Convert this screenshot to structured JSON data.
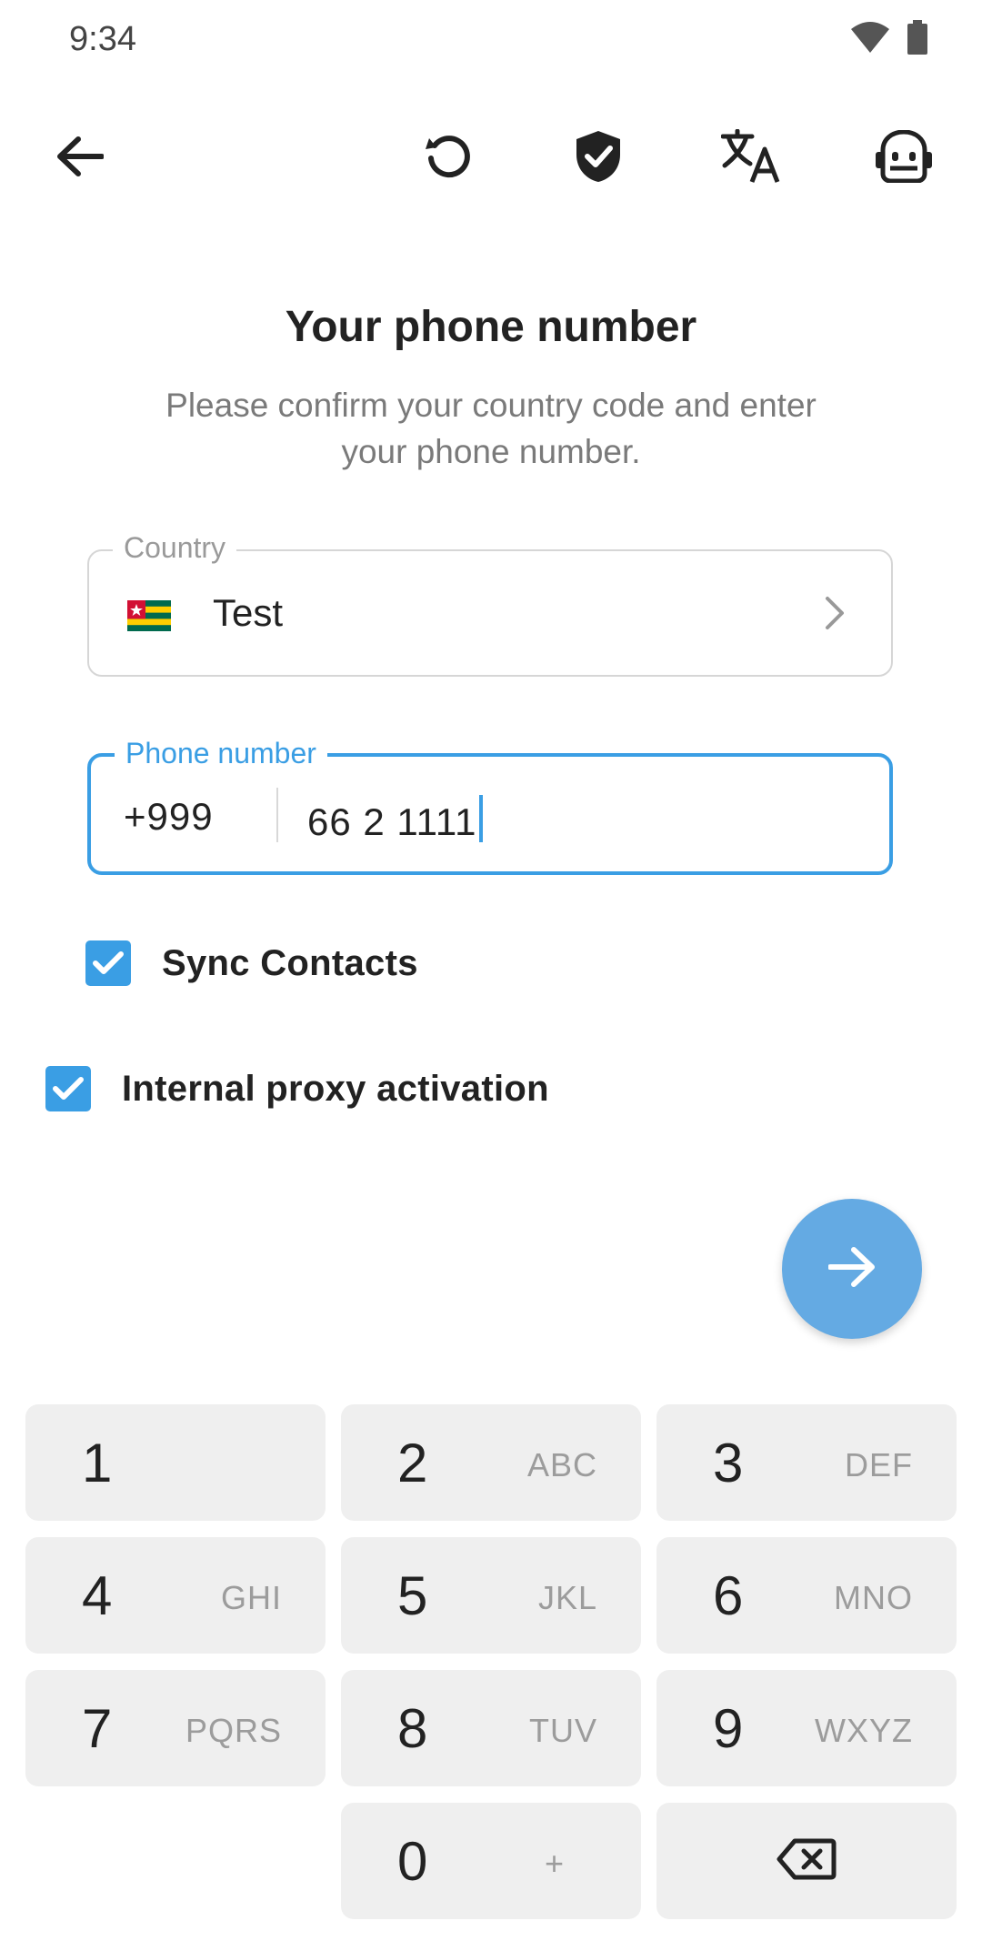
{
  "status_bar": {
    "time": "9:34"
  },
  "header": {
    "title": "Your phone number",
    "subtitle": "Please confirm your country code and enter your phone number."
  },
  "country_field": {
    "legend": "Country",
    "value": "Test",
    "flag": "togo-flag"
  },
  "phone_field": {
    "legend": "Phone number",
    "code": "+999",
    "number": "66 2 1111"
  },
  "checkboxes": {
    "sync_contacts": {
      "label": "Sync Contacts",
      "checked": true
    },
    "internal_proxy": {
      "label": "Internal proxy activation",
      "checked": true
    }
  },
  "toolbar_icons": [
    "back-arrow-icon",
    "reset-icon",
    "shield-check-icon",
    "translate-icon",
    "bot-icon"
  ],
  "keypad": {
    "keys": [
      {
        "digit": "1",
        "letters": ""
      },
      {
        "digit": "2",
        "letters": "ABC"
      },
      {
        "digit": "3",
        "letters": "DEF"
      },
      {
        "digit": "4",
        "letters": "GHI"
      },
      {
        "digit": "5",
        "letters": "JKL"
      },
      {
        "digit": "6",
        "letters": "MNO"
      },
      {
        "digit": "7",
        "letters": "PQRS"
      },
      {
        "digit": "8",
        "letters": "TUV"
      },
      {
        "digit": "9",
        "letters": "WXYZ"
      },
      {
        "digit": "0",
        "letters": "+"
      }
    ]
  },
  "colors": {
    "accent": "#3a9ee4",
    "fab": "#64aae3",
    "key_bg": "#efefef"
  }
}
